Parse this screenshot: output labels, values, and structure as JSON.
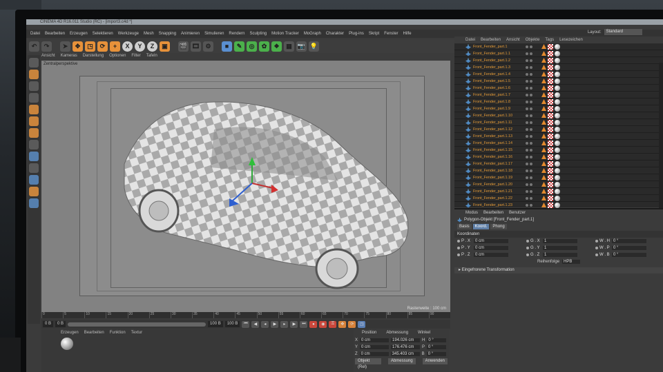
{
  "app": {
    "title": "CINEMA 4D R16.011 Studio (RC) - [import3.c4d *]"
  },
  "menu": [
    "Datei",
    "Bearbeiten",
    "Erzeugen",
    "Selektieren",
    "Werkzeuge",
    "Mesh",
    "Snapping",
    "Animieren",
    "Simulieren",
    "Rendern",
    "Sculpting",
    "Motion Tracker",
    "MoGraph",
    "Charakter",
    "Plug-ins",
    "Skript",
    "Fenster",
    "Hilfe"
  ],
  "layout": {
    "label": "Layout:",
    "value": "Standard"
  },
  "toolbar": {
    "x": "X",
    "y": "Y",
    "z": "Z"
  },
  "viewport": {
    "menu": [
      "Ansicht",
      "Kameras",
      "Darstellung",
      "Optionen",
      "Filter",
      "Tafeln"
    ],
    "label": "Zentralperspektive",
    "radius": "Rasterweite : 100 cm"
  },
  "timeline": {
    "ticks": [
      "0",
      "5",
      "10",
      "15",
      "20",
      "25",
      "30",
      "35",
      "40",
      "45",
      "50",
      "55",
      "60",
      "65",
      "70",
      "75",
      "80",
      "85",
      "90"
    ],
    "start": "0 B",
    "min": "0 B",
    "max": "100 B",
    "end": "100 B",
    "current": "0 B"
  },
  "material_manager": {
    "menu": [
      "Erzeugen",
      "Bearbeiten",
      "Funktion",
      "Textur"
    ]
  },
  "coordinates": {
    "headers": [
      "Position",
      "Abmessung",
      "Winkel"
    ],
    "rows": [
      {
        "axis": "X",
        "pos": "0 cm",
        "size": "194.026 cm",
        "ang_label": "H",
        "ang": "0 °"
      },
      {
        "axis": "Y",
        "pos": "0 cm",
        "size": "176.476 cm",
        "ang_label": "P",
        "ang": "0 °"
      },
      {
        "axis": "Z",
        "pos": "0 cm",
        "size": "345.403 cm",
        "ang_label": "B",
        "ang": "0 °"
      }
    ],
    "mode": "Objekt (Rel)",
    "measure": "Abmessung",
    "apply": "Anwenden"
  },
  "object_manager": {
    "menu": [
      "Datei",
      "Bearbeiten",
      "Ansicht",
      "Objekte",
      "Tags",
      "Lesezeichen"
    ],
    "objects": [
      "Front_Fender_part.1",
      "Front_Fender_part.1.1",
      "Front_Fender_part.1.2",
      "Front_Fender_part.1.3",
      "Front_Fender_part.1.4",
      "Front_Fender_part.1.5",
      "Front_Fender_part.1.6",
      "Front_Fender_part.1.7",
      "Front_Fender_part.1.8",
      "Front_Fender_part.1.9",
      "Front_Fender_part.1.10",
      "Front_Fender_part.1.11",
      "Front_Fender_part.1.12",
      "Front_Fender_part.1.13",
      "Front_Fender_part.1.14",
      "Front_Fender_part.1.15",
      "Front_Fender_part.1.16",
      "Front_Fender_part.1.17",
      "Front_Fender_part.1.18",
      "Front_Fender_part.1.19",
      "Front_Fender_part.1.20",
      "Front_Fender_part.1.21",
      "Front_Fender_part.1.22",
      "Front_Fender_part.1.23"
    ]
  },
  "attribute_manager": {
    "menu": [
      "Modus",
      "Bearbeiten",
      "Benutzer"
    ],
    "object": "Polygon-Objekt [Front_Fender_part.1]",
    "tabs": [
      "Basis",
      "Koord.",
      "Phong"
    ],
    "active_tab": "Koord.",
    "section": "Koordinaten",
    "rows": [
      [
        {
          "k": "P . X",
          "v": "0 cm"
        },
        {
          "k": "G . X",
          "v": "1"
        },
        {
          "k": "W . H",
          "v": "0 °"
        }
      ],
      [
        {
          "k": "P . Y",
          "v": "0 cm"
        },
        {
          "k": "G . Y",
          "v": "1"
        },
        {
          "k": "W . P",
          "v": "0 °"
        }
      ],
      [
        {
          "k": "P . Z",
          "v": "0 cm"
        },
        {
          "k": "G . Z",
          "v": "1"
        },
        {
          "k": "W . B",
          "v": "0 °"
        }
      ]
    ],
    "order_label": "Reihenfolge",
    "order_value": "HPB",
    "frozen": "▸ Eingefrorene Transformation"
  }
}
